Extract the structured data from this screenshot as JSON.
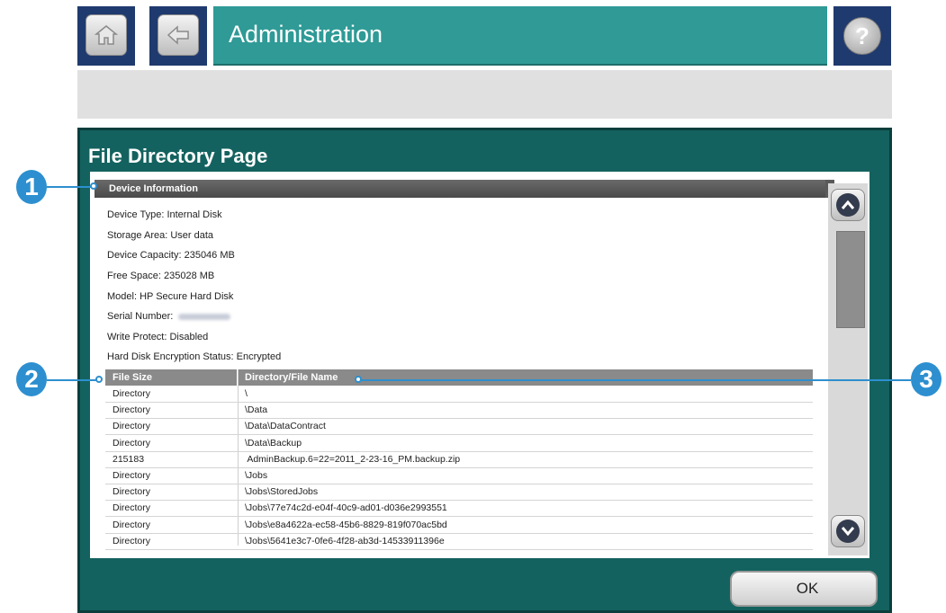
{
  "header": {
    "title": "Administration",
    "home_icon": "home-icon",
    "back_icon": "back-arrow-icon",
    "help_label": "?"
  },
  "panel": {
    "title": "File Directory Page",
    "section_title": "Device Information",
    "info": {
      "device_type": "Device Type: Internal Disk",
      "storage_area": "Storage Area: User data",
      "capacity": "Device Capacity: 235046 MB",
      "free_space": "Free Space: 235028 MB",
      "model": "Model: HP Secure Hard Disk",
      "serial": "Serial Number:",
      "write_protect": "Write Protect: Disabled",
      "encryption": "Hard Disk Encryption Status: Encrypted"
    },
    "table": {
      "headers": [
        "File Size",
        "Directory/File Name"
      ],
      "rows": [
        [
          "Directory",
          "\\"
        ],
        [
          "Directory",
          "\\Data"
        ],
        [
          "Directory",
          "\\Data\\DataContract"
        ],
        [
          "Directory",
          "\\Data\\Backup"
        ],
        [
          "215183",
          " AdminBackup.6=22=2011_2-23-16_PM.backup.zip"
        ],
        [
          "Directory",
          "\\Jobs"
        ],
        [
          "Directory",
          "\\Jobs\\StoredJobs"
        ],
        [
          "Directory",
          "\\Jobs\\77e74c2d-e04f-40c9-ad01-d036e2993551"
        ],
        [
          "Directory",
          "\\Jobs\\e8a4622a-ec58-45b6-8829-819f070ac5bd"
        ],
        [
          "Directory",
          "\\Jobs\\5641e3c7-0fe6-4f28-ab3d-14533911396e"
        ]
      ]
    },
    "ok_label": "OK"
  },
  "callouts": [
    "1",
    "2",
    "3"
  ],
  "colors": {
    "title_bar": "#2f9a96",
    "nav_button_bg": "#1f3a6e",
    "panel_bg": "#14625f",
    "callout": "#2d8fcf"
  }
}
